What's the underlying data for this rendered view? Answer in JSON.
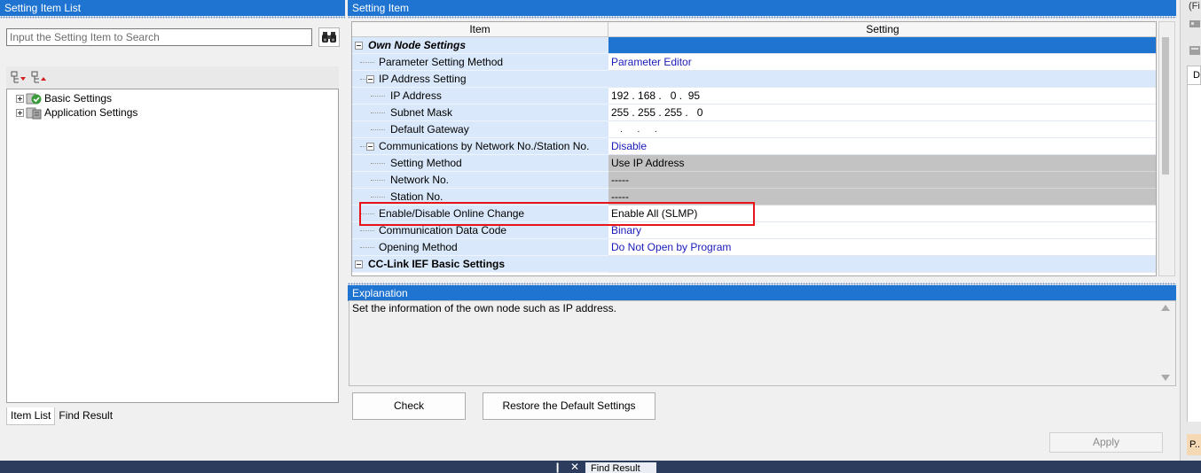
{
  "left_panel": {
    "title": "Setting Item List",
    "search_placeholder": "Input the Setting Item to Search",
    "tree": [
      {
        "label": "Basic Settings"
      },
      {
        "label": "Application Settings"
      }
    ],
    "tabs": [
      {
        "label": "Item List"
      },
      {
        "label": "Find Result"
      }
    ]
  },
  "setting_panel": {
    "title": "Setting Item",
    "columns": {
      "item": "Item",
      "setting": "Setting"
    },
    "rows": [
      {
        "item": "Own Node Settings",
        "setting": ""
      },
      {
        "item": "Parameter Setting Method",
        "setting": "Parameter Editor"
      },
      {
        "item": "IP Address Setting",
        "setting": ""
      },
      {
        "item": "IP Address",
        "setting": "192 . 168 .   0 .  95"
      },
      {
        "item": "Subnet Mask",
        "setting": "255 . 255 . 255 .   0"
      },
      {
        "item": "Default Gateway",
        "setting": ".      .      ."
      },
      {
        "item": "Communications by Network No./Station No.",
        "setting": "Disable"
      },
      {
        "item": "Setting Method",
        "setting": "Use IP Address"
      },
      {
        "item": "Network No.",
        "setting": "-----"
      },
      {
        "item": "Station No.",
        "setting": "-----"
      },
      {
        "item": "Enable/Disable Online Change",
        "setting": "Enable All (SLMP)"
      },
      {
        "item": "Communication Data Code",
        "setting": "Binary"
      },
      {
        "item": "Opening Method",
        "setting": "Do Not Open by Program"
      },
      {
        "item": "CC-Link IEF Basic Settings",
        "setting": ""
      }
    ]
  },
  "explanation": {
    "title": "Explanation",
    "text": "Set the information of the own node such as IP address."
  },
  "buttons": {
    "check": "Check",
    "restore": "Restore the Default Settings",
    "apply": "Apply"
  },
  "right_sliver": {
    "top_text": "(Fi",
    "tab_text": "D",
    "bottom_text": "P..."
  },
  "bottom_bar": {
    "tab_label": "Find Result"
  },
  "colors": {
    "accent": "#1e74d0",
    "item_bg": "#d9e8fa",
    "highlight": "#e8141a",
    "setting_link": "#1a1aba",
    "disabled_gray": "#c3c3c3"
  }
}
